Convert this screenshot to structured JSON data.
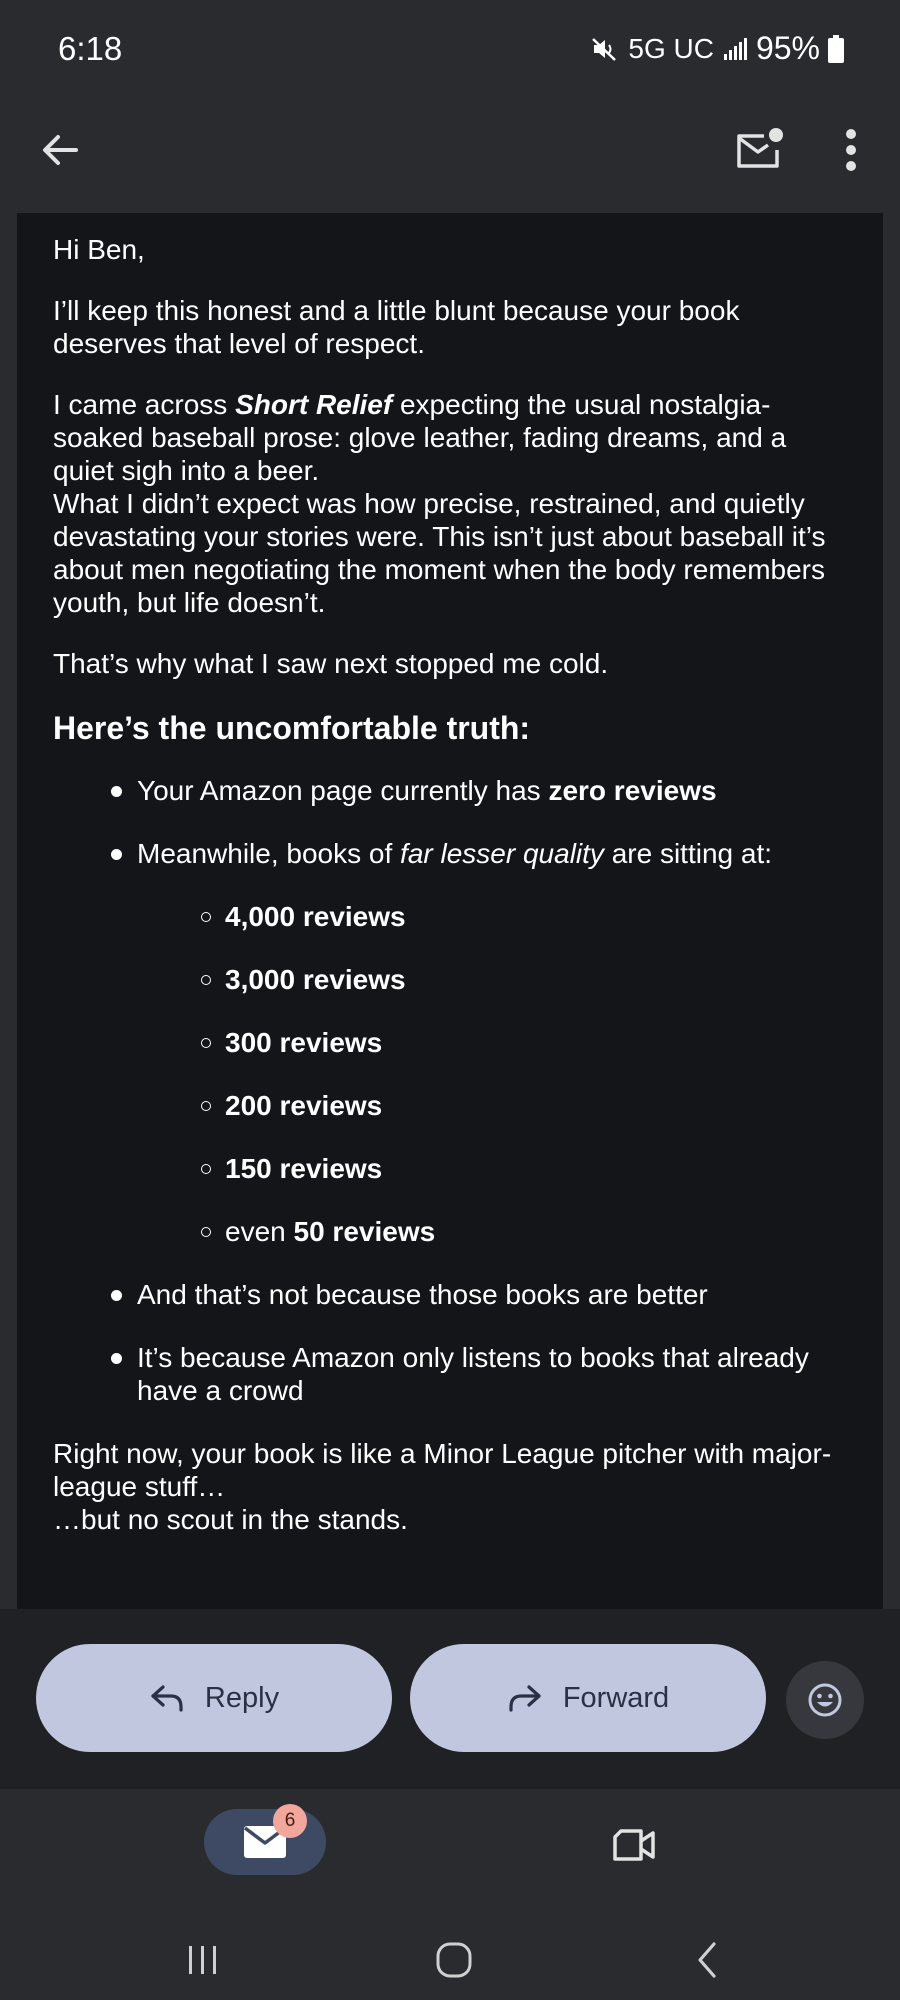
{
  "status_bar": {
    "time": "6:18",
    "network": "5G UC",
    "battery": "95%"
  },
  "email": {
    "greeting": "Hi Ben,",
    "p1": "I’ll keep this honest and a little blunt because your book deserves that level of respect.",
    "p2": {
      "before": "I came across ",
      "title": "Short Relief",
      "after": " expecting the usual nostalgia-soaked baseball prose: glove leather, fading dreams, and a quiet sigh into a beer.",
      "line2": "What I didn’t expect was how precise, restrained, and quietly devastating your stories were. This isn’t just about baseball it’s about men negotiating the moment when the body remembers youth, but life doesn’t."
    },
    "p3": "That’s why what I saw next stopped me cold.",
    "heading": "Here’s the uncomfortable truth:",
    "bullet1": {
      "text": "Your Amazon page currently has ",
      "bold": "zero reviews"
    },
    "bullet2": {
      "before": "Meanwhile, books of ",
      "italic": "far lesser quality",
      "after": " are sitting at:"
    },
    "sub_items": [
      "4,000 reviews",
      "3,000 reviews",
      "300 reviews",
      "200 reviews",
      "150 reviews"
    ],
    "sub_last": {
      "prefix": "even ",
      "bold": "50 reviews"
    },
    "bullet3": "And that’s not because those books are better",
    "bullet4": "It’s because Amazon only listens to books that already have a crowd",
    "closing_line1": "Right now, your book is like a Minor League pitcher with major-league stuff…",
    "closing_line2": "…but no scout in the stands."
  },
  "actions": {
    "reply_label": "Reply",
    "forward_label": "Forward"
  },
  "bottom_nav": {
    "mail_badge": "6"
  },
  "colors": {
    "background": "#2a2b2f",
    "content_bg": "#141519",
    "pill": "#c1c7de",
    "badge": "#f1a79b",
    "mail_tab": "#3e4a63"
  },
  "icons": {
    "back": "arrow-left-icon",
    "mark_unread": "mail-unread-icon",
    "more": "more-vert-icon",
    "reply": "reply-icon",
    "forward": "forward-icon",
    "emoji": "emoji-icon",
    "mail": "mail-icon",
    "meet": "video-camera-icon"
  }
}
